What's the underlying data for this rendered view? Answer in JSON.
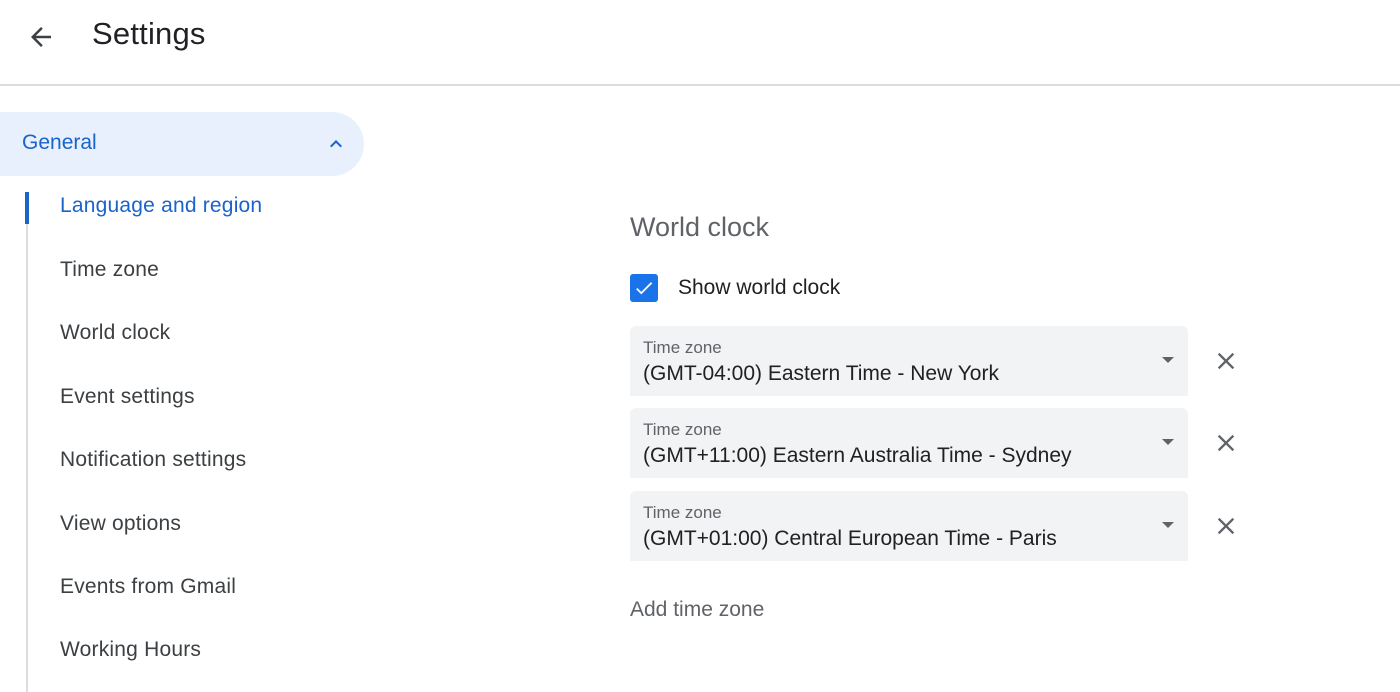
{
  "header": {
    "title": "Settings",
    "back_icon": "arrow-back-icon"
  },
  "sidebar": {
    "group": {
      "label": "General",
      "icon": "chevron-up-icon",
      "expanded": true
    },
    "items": [
      {
        "label": "Language and region",
        "active": true
      },
      {
        "label": "Time zone",
        "active": false
      },
      {
        "label": "World clock",
        "active": false
      },
      {
        "label": "Event settings",
        "active": false
      },
      {
        "label": "Notification settings",
        "active": false
      },
      {
        "label": "View options",
        "active": false
      },
      {
        "label": "Events from Gmail",
        "active": false
      },
      {
        "label": "Working Hours",
        "active": false
      }
    ]
  },
  "world_clock": {
    "title": "World clock",
    "show_checkbox": {
      "label": "Show world clock",
      "checked": true
    },
    "timezones": [
      {
        "label": "Time zone",
        "value": "(GMT-04:00) Eastern Time - New York"
      },
      {
        "label": "Time zone",
        "value": "(GMT+11:00) Eastern Australia Time - Sydney"
      },
      {
        "label": "Time zone",
        "value": "(GMT+01:00) Central European Time - Paris"
      }
    ],
    "add_label": "Add time zone"
  },
  "colors": {
    "accent": "#1a73e8",
    "active_text": "#1a63c9",
    "active_bg": "#e8f0fe",
    "field_bg": "#f1f3f4"
  }
}
